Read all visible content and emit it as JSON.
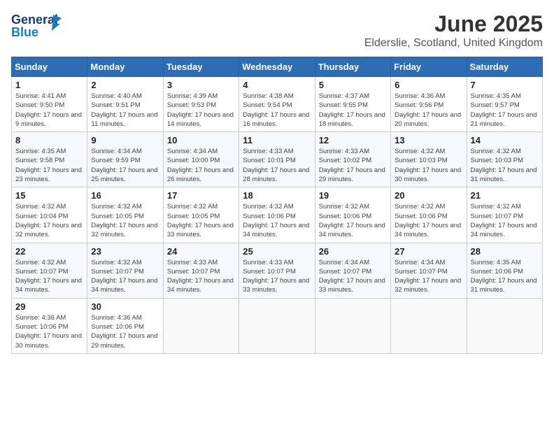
{
  "header": {
    "logo_general": "General",
    "logo_blue": "Blue",
    "title": "June 2025",
    "subtitle": "Elderslie, Scotland, United Kingdom"
  },
  "days_of_week": [
    "Sunday",
    "Monday",
    "Tuesday",
    "Wednesday",
    "Thursday",
    "Friday",
    "Saturday"
  ],
  "weeks": [
    [
      {
        "day": "1",
        "sunrise": "Sunrise: 4:41 AM",
        "sunset": "Sunset: 9:50 PM",
        "daylight": "Daylight: 17 hours and 9 minutes."
      },
      {
        "day": "2",
        "sunrise": "Sunrise: 4:40 AM",
        "sunset": "Sunset: 9:51 PM",
        "daylight": "Daylight: 17 hours and 11 minutes."
      },
      {
        "day": "3",
        "sunrise": "Sunrise: 4:39 AM",
        "sunset": "Sunset: 9:53 PM",
        "daylight": "Daylight: 17 hours and 14 minutes."
      },
      {
        "day": "4",
        "sunrise": "Sunrise: 4:38 AM",
        "sunset": "Sunset: 9:54 PM",
        "daylight": "Daylight: 17 hours and 16 minutes."
      },
      {
        "day": "5",
        "sunrise": "Sunrise: 4:37 AM",
        "sunset": "Sunset: 9:55 PM",
        "daylight": "Daylight: 17 hours and 18 minutes."
      },
      {
        "day": "6",
        "sunrise": "Sunrise: 4:36 AM",
        "sunset": "Sunset: 9:56 PM",
        "daylight": "Daylight: 17 hours and 20 minutes."
      },
      {
        "day": "7",
        "sunrise": "Sunrise: 4:35 AM",
        "sunset": "Sunset: 9:57 PM",
        "daylight": "Daylight: 17 hours and 21 minutes."
      }
    ],
    [
      {
        "day": "8",
        "sunrise": "Sunrise: 4:35 AM",
        "sunset": "Sunset: 9:58 PM",
        "daylight": "Daylight: 17 hours and 23 minutes."
      },
      {
        "day": "9",
        "sunrise": "Sunrise: 4:34 AM",
        "sunset": "Sunset: 9:59 PM",
        "daylight": "Daylight: 17 hours and 25 minutes."
      },
      {
        "day": "10",
        "sunrise": "Sunrise: 4:34 AM",
        "sunset": "Sunset: 10:00 PM",
        "daylight": "Daylight: 17 hours and 26 minutes."
      },
      {
        "day": "11",
        "sunrise": "Sunrise: 4:33 AM",
        "sunset": "Sunset: 10:01 PM",
        "daylight": "Daylight: 17 hours and 28 minutes."
      },
      {
        "day": "12",
        "sunrise": "Sunrise: 4:33 AM",
        "sunset": "Sunset: 10:02 PM",
        "daylight": "Daylight: 17 hours and 29 minutes."
      },
      {
        "day": "13",
        "sunrise": "Sunrise: 4:32 AM",
        "sunset": "Sunset: 10:03 PM",
        "daylight": "Daylight: 17 hours and 30 minutes."
      },
      {
        "day": "14",
        "sunrise": "Sunrise: 4:32 AM",
        "sunset": "Sunset: 10:03 PM",
        "daylight": "Daylight: 17 hours and 31 minutes."
      }
    ],
    [
      {
        "day": "15",
        "sunrise": "Sunrise: 4:32 AM",
        "sunset": "Sunset: 10:04 PM",
        "daylight": "Daylight: 17 hours and 32 minutes."
      },
      {
        "day": "16",
        "sunrise": "Sunrise: 4:32 AM",
        "sunset": "Sunset: 10:05 PM",
        "daylight": "Daylight: 17 hours and 32 minutes."
      },
      {
        "day": "17",
        "sunrise": "Sunrise: 4:32 AM",
        "sunset": "Sunset: 10:05 PM",
        "daylight": "Daylight: 17 hours and 33 minutes."
      },
      {
        "day": "18",
        "sunrise": "Sunrise: 4:32 AM",
        "sunset": "Sunset: 10:06 PM",
        "daylight": "Daylight: 17 hours and 34 minutes."
      },
      {
        "day": "19",
        "sunrise": "Sunrise: 4:32 AM",
        "sunset": "Sunset: 10:06 PM",
        "daylight": "Daylight: 17 hours and 34 minutes."
      },
      {
        "day": "20",
        "sunrise": "Sunrise: 4:32 AM",
        "sunset": "Sunset: 10:06 PM",
        "daylight": "Daylight: 17 hours and 34 minutes."
      },
      {
        "day": "21",
        "sunrise": "Sunrise: 4:32 AM",
        "sunset": "Sunset: 10:07 PM",
        "daylight": "Daylight: 17 hours and 34 minutes."
      }
    ],
    [
      {
        "day": "22",
        "sunrise": "Sunrise: 4:32 AM",
        "sunset": "Sunset: 10:07 PM",
        "daylight": "Daylight: 17 hours and 34 minutes."
      },
      {
        "day": "23",
        "sunrise": "Sunrise: 4:32 AM",
        "sunset": "Sunset: 10:07 PM",
        "daylight": "Daylight: 17 hours and 34 minutes."
      },
      {
        "day": "24",
        "sunrise": "Sunrise: 4:33 AM",
        "sunset": "Sunset: 10:07 PM",
        "daylight": "Daylight: 17 hours and 34 minutes."
      },
      {
        "day": "25",
        "sunrise": "Sunrise: 4:33 AM",
        "sunset": "Sunset: 10:07 PM",
        "daylight": "Daylight: 17 hours and 33 minutes."
      },
      {
        "day": "26",
        "sunrise": "Sunrise: 4:34 AM",
        "sunset": "Sunset: 10:07 PM",
        "daylight": "Daylight: 17 hours and 33 minutes."
      },
      {
        "day": "27",
        "sunrise": "Sunrise: 4:34 AM",
        "sunset": "Sunset: 10:07 PM",
        "daylight": "Daylight: 17 hours and 32 minutes."
      },
      {
        "day": "28",
        "sunrise": "Sunrise: 4:35 AM",
        "sunset": "Sunset: 10:06 PM",
        "daylight": "Daylight: 17 hours and 31 minutes."
      }
    ],
    [
      {
        "day": "29",
        "sunrise": "Sunrise: 4:36 AM",
        "sunset": "Sunset: 10:06 PM",
        "daylight": "Daylight: 17 hours and 30 minutes."
      },
      {
        "day": "30",
        "sunrise": "Sunrise: 4:36 AM",
        "sunset": "Sunset: 10:06 PM",
        "daylight": "Daylight: 17 hours and 29 minutes."
      },
      null,
      null,
      null,
      null,
      null
    ]
  ]
}
